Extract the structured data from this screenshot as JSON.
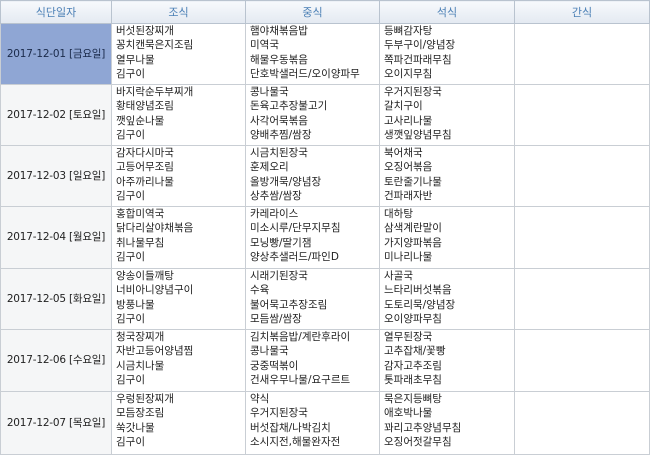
{
  "headers": {
    "date": "식단일자",
    "breakfast": "조식",
    "lunch": "중식",
    "dinner": "석식",
    "snack": "간식"
  },
  "rows": [
    {
      "date": "2017-12-01 [금요일]",
      "breakfast": [
        "버섯된장찌개",
        "꽁치캔묵은지조림",
        "열무나물",
        "김구이"
      ],
      "lunch": [
        "햄야채볶음밥",
        "미역국",
        "해물우동볶음",
        "단호박샐러드/오이양파무"
      ],
      "dinner": [
        "등뼈감자탕",
        "두부구이/양념장",
        "쪽파건파래무침",
        "오이지무침"
      ],
      "snack": []
    },
    {
      "date": "2017-12-02 [토요일]",
      "breakfast": [
        "바지락순두부찌개",
        "황태양념조림",
        "깻잎순나물",
        "김구이"
      ],
      "lunch": [
        "콩나물국",
        "돈육고추장불고기",
        "사각어묵볶음",
        "양배추찜/쌈장"
      ],
      "dinner": [
        "우거지된장국",
        "갈치구이",
        "고사리나물",
        "생깻잎양념무침"
      ],
      "snack": []
    },
    {
      "date": "2017-12-03 [일요일]",
      "breakfast": [
        "감자다시마국",
        "고등어무조림",
        "아주까리나물",
        "김구이"
      ],
      "lunch": [
        "시금치된장국",
        "훈제오리",
        "올방개묵/양념장",
        "상추쌈/쌈장"
      ],
      "dinner": [
        "북어채국",
        "오징어볶음",
        "토란줄기나물",
        "건파래자반"
      ],
      "snack": []
    },
    {
      "date": "2017-12-04 [월요일]",
      "breakfast": [
        "홍합미역국",
        "닭다리살야채볶음",
        "취나물무침",
        "김구이"
      ],
      "lunch": [
        "카레라이스",
        "미소시루/단무지무침",
        "모닝빵/딸기잼",
        "양상추샐러드/파인D"
      ],
      "dinner": [
        "대하탕",
        "삼색계란말이",
        "가지양파볶음",
        "미나리나물"
      ],
      "snack": []
    },
    {
      "date": "2017-12-05 [화요일]",
      "breakfast": [
        "양송이들깨탕",
        "너비아니양념구이",
        "방풍나물",
        "김구이"
      ],
      "lunch": [
        "시래기된장국",
        "수육",
        "불어묵고추장조림",
        "모듬쌈/쌈장"
      ],
      "dinner": [
        "사골국",
        "느타리버섯볶음",
        "도토리묵/양념장",
        "오이양파무침"
      ],
      "snack": []
    },
    {
      "date": "2017-12-06 [수요일]",
      "breakfast": [
        "청국장찌개",
        "자반고등어양념찜",
        "시금치나물",
        "김구이"
      ],
      "lunch": [
        "김치볶음밥/계란후라이",
        "콩나물국",
        "궁중떡볶이",
        "건새우무나물/요구르트"
      ],
      "dinner": [
        "열무된장국",
        "고추잡채/꽃빵",
        "감자고추조림",
        "톳파래초무침"
      ],
      "snack": []
    },
    {
      "date": "2017-12-07 [목요일]",
      "breakfast": [
        "우렁된장찌개",
        "모듬장조림",
        "쑥갓나물",
        "김구이"
      ],
      "lunch": [
        "약식",
        "우거지된장국",
        "버섯잡채/나박김치",
        "소시지전,해물완자전"
      ],
      "dinner": [
        "묵은지등뼈탕",
        "애호박나물",
        "꽈리고추양념무침",
        "오징어젓갈무침"
      ],
      "snack": []
    }
  ]
}
